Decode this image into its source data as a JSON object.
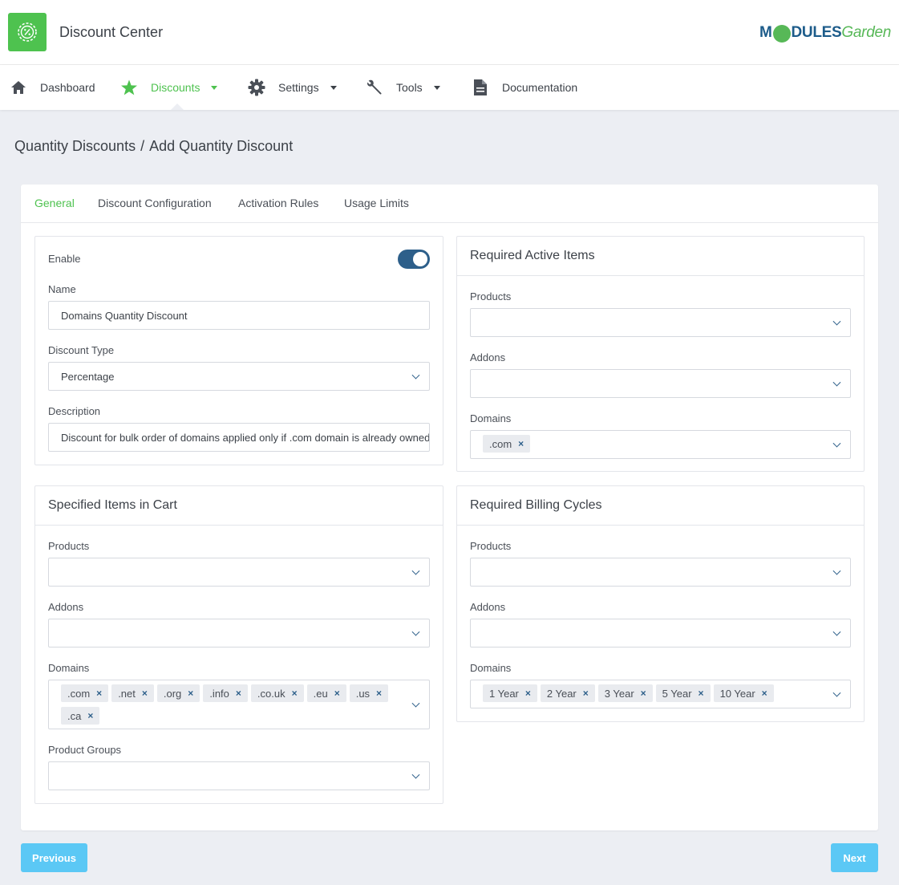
{
  "app": {
    "title": "Discount Center",
    "brand_left": "M",
    "brand_mid": "DULES",
    "brand_right": "Garden",
    "accent": "#4ec24f",
    "primary": "#2d5f8a",
    "button_color": "#5bc8f5"
  },
  "nav": {
    "items": [
      {
        "label": "Dashboard",
        "icon": "home-icon"
      },
      {
        "label": "Discounts",
        "icon": "star-icon"
      },
      {
        "label": "Settings",
        "icon": "gear-icon"
      },
      {
        "label": "Tools",
        "icon": "wrench-icon"
      },
      {
        "label": "Documentation",
        "icon": "document-icon"
      }
    ]
  },
  "breadcrumb": {
    "parent": "Quantity Discounts",
    "separator": "/",
    "current": "Add Quantity Discount"
  },
  "tabs": [
    {
      "label": "General"
    },
    {
      "label": "Discount Configuration"
    },
    {
      "label": "Activation Rules"
    },
    {
      "label": "Usage Limits"
    }
  ],
  "general": {
    "enable_label": "Enable",
    "enabled": true,
    "name_label": "Name",
    "name_value": "Domains Quantity  Discount",
    "type_label": "Discount Type",
    "type_value": "Percentage",
    "description_label": "Description",
    "description_value": "Discount for bulk order of domains applied only if .com domain is already owned"
  },
  "required_active": {
    "title": "Required Active Items",
    "products_label": "Products",
    "addons_label": "Addons",
    "domains_label": "Domains",
    "domains": [
      ".com"
    ]
  },
  "specified": {
    "title": "Specified Items in Cart",
    "products_label": "Products",
    "addons_label": "Addons",
    "domains_label": "Domains",
    "domains": [
      ".com",
      ".net",
      ".org",
      ".info",
      ".co.uk",
      ".eu",
      ".us",
      ".ca"
    ],
    "groups_label": "Product Groups"
  },
  "billing": {
    "title": "Required Billing Cycles",
    "products_label": "Products",
    "addons_label": "Addons",
    "domains_label": "Domains",
    "domains": [
      "1 Year",
      "2 Year",
      "3 Year",
      "5 Year",
      "10 Year"
    ]
  },
  "actions": {
    "previous": "Previous",
    "next": "Next"
  }
}
